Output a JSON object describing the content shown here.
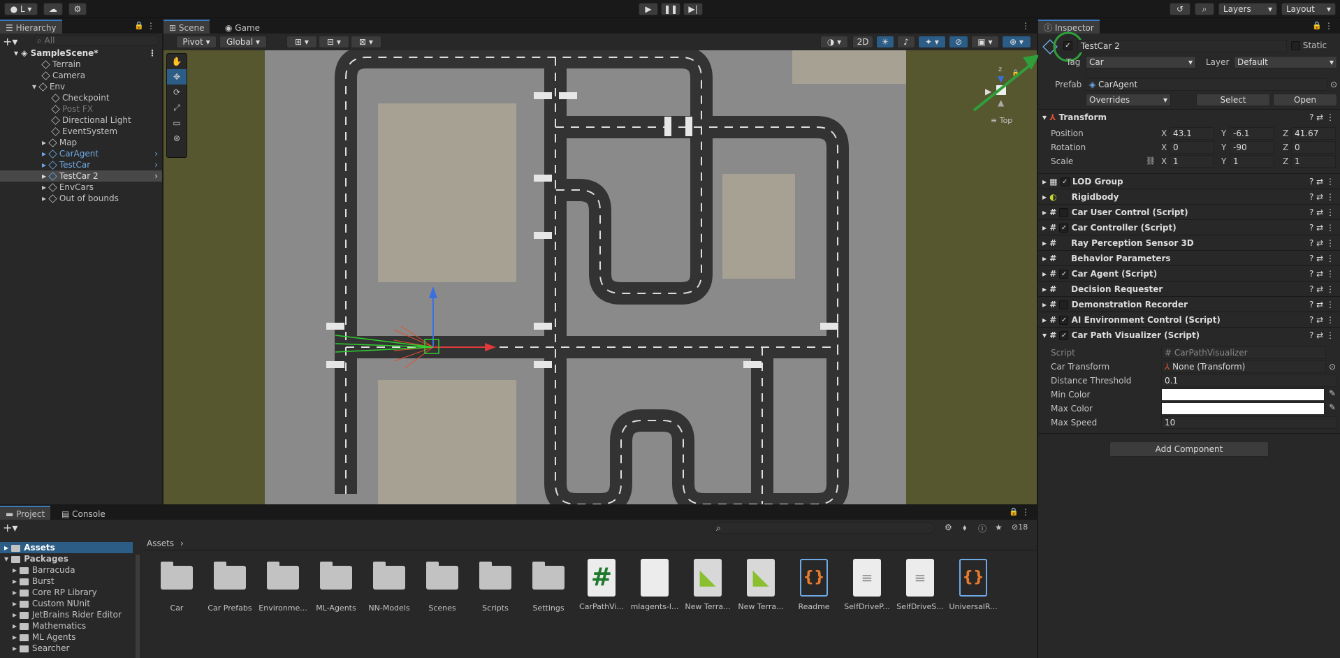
{
  "toolbar": {
    "account": "L",
    "layers": "Layers",
    "layout": "Layout"
  },
  "hierarchy": {
    "tab": "Hierarchy",
    "search": "All",
    "scene": "SampleScene*",
    "items": [
      "Terrain",
      "Camera",
      "Env",
      "Checkpoint",
      "Post FX",
      "Directional Light",
      "EventSystem",
      "Map",
      "CarAgent",
      "TestCar",
      "TestCar 2",
      "EnvCars",
      "Out of bounds"
    ]
  },
  "scene": {
    "tabs": [
      "Scene",
      "Game"
    ],
    "pivot": "Pivot",
    "global": "Global",
    "mode2d": "2D",
    "view": "Top",
    "axis_z": "z",
    "axis_x": "x"
  },
  "inspector": {
    "tab": "Inspector",
    "name": "TestCar 2",
    "static": "Static",
    "tag_label": "Tag",
    "tag": "Car",
    "layer_label": "Layer",
    "layer": "Default",
    "prefab_label": "Prefab",
    "prefab": "CarAgent",
    "overrides": "Overrides",
    "select": "Select",
    "open": "Open",
    "transform": {
      "title": "Transform",
      "position": "Position",
      "rotation": "Rotation",
      "scale": "Scale",
      "pos": [
        "43.1",
        "-6.1",
        "41.67"
      ],
      "rot": [
        "0",
        "-90",
        "0"
      ],
      "scl": [
        "1",
        "1",
        "1"
      ],
      "x": "X",
      "y": "Y",
      "z": "Z"
    },
    "components": [
      "LOD Group",
      "Rigidbody",
      "Car User Control (Script)",
      "Car Controller (Script)",
      "Ray Perception Sensor 3D",
      "Behavior Parameters",
      "Car Agent (Script)",
      "Decision Requester",
      "Demonstration Recorder",
      "AI Environment Control (Script)",
      "Car Path Visualizer (Script)"
    ],
    "cpv": {
      "script_label": "Script",
      "script": "CarPathVisualizer",
      "car_transform_label": "Car Transform",
      "car_transform": "None (Transform)",
      "dist_label": "Distance Threshold",
      "dist": "0.1",
      "min_color_label": "Min Color",
      "max_color_label": "Max Color",
      "max_speed_label": "Max Speed",
      "max_speed": "10"
    },
    "add_component": "Add Component"
  },
  "project": {
    "tabs": [
      "Project",
      "Console"
    ],
    "count": "18",
    "breadcrumb": "Assets",
    "tree": [
      "Assets",
      "Packages",
      "Barracuda",
      "Burst",
      "Core RP Library",
      "Custom NUnit",
      "JetBrains Rider Editor",
      "Mathematics",
      "ML Agents",
      "Searcher"
    ],
    "assets": [
      "Car",
      "Car Prefabs",
      "Environme...",
      "ML-Agents",
      "NN-Models",
      "Scenes",
      "Scripts",
      "Settings",
      "CarPathVi...",
      "mlagents-l...",
      "New Terra...",
      "New Terra...",
      "Readme",
      "SelfDriveP...",
      "SelfDriveS...",
      "UniversalR..."
    ]
  },
  "colors": {
    "accent": "#3a79bb",
    "highlight": "#2f8f3a",
    "selection": "#2c5d87"
  }
}
